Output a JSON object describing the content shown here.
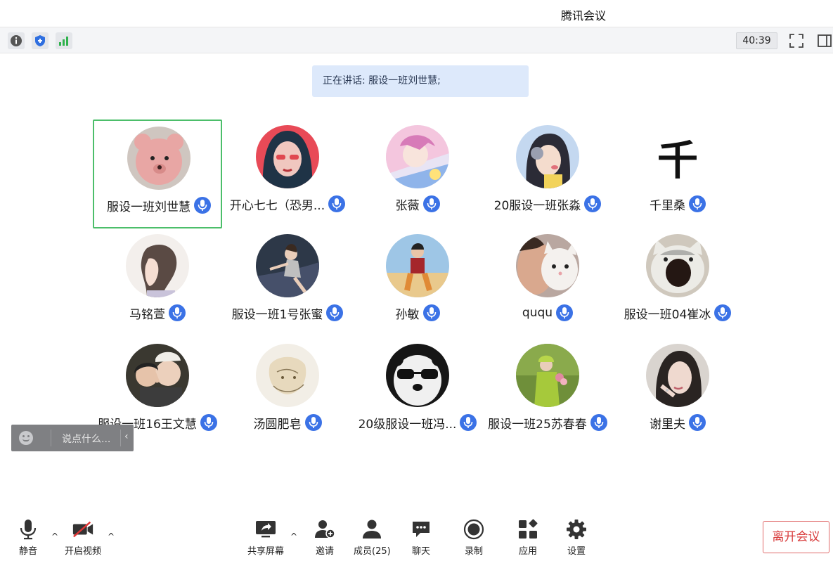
{
  "window": {
    "title": "腾讯会议"
  },
  "topbar": {
    "timer": "40:39"
  },
  "speaking_banner": "正在讲话: 服设一班刘世慧;",
  "participants": [
    {
      "name": "服设一班刘世慧",
      "speaking": true
    },
    {
      "name": "开心七七（恐男..."
    },
    {
      "name": "张薇"
    },
    {
      "name": "20服设一班张淼"
    },
    {
      "name": "千里桑"
    },
    {
      "name": "马铭萱"
    },
    {
      "name": "服设一班1号张蜜"
    },
    {
      "name": "孙敏"
    },
    {
      "name": "ququ"
    },
    {
      "name": "服设一班04崔冰"
    },
    {
      "name": "服设一班16王文慧"
    },
    {
      "name": "汤圆肥皂"
    },
    {
      "name": "20级服设一班冯..."
    },
    {
      "name": "服设一班25苏春春"
    },
    {
      "name": "谢里夫"
    }
  ],
  "avatar_glyph_qianlisang": "千",
  "chat": {
    "placeholder": "说点什么..."
  },
  "toolbar": {
    "mute": "静音",
    "video": "开启视频",
    "share": "共享屏幕",
    "invite": "邀请",
    "members": "成员(25)",
    "chat": "聊天",
    "record": "录制",
    "apps": "应用",
    "settings": "设置",
    "leave": "离开会议"
  },
  "colors": {
    "active_border": "#4cbe6a",
    "mic_blue": "#3b72e6",
    "leave_red": "#d83b3b",
    "banner_bg": "#dde9fb"
  }
}
